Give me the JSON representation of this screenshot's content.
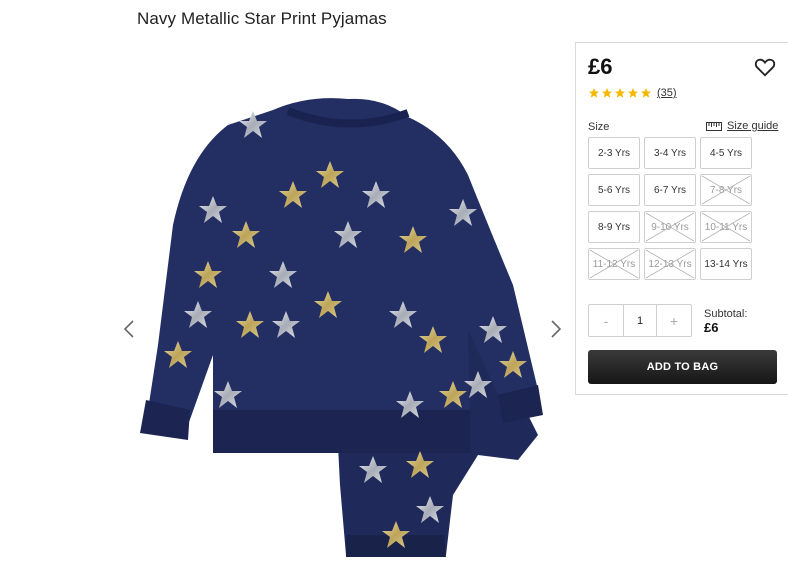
{
  "product": {
    "title": "Navy Metallic Star Print Pyjamas",
    "image_icon": "pyjamas-product-photo"
  },
  "gallery": {
    "prev_icon": "chevron-left-icon",
    "next_icon": "chevron-right-icon"
  },
  "purchase": {
    "price": "£6",
    "wishlist_icon": "heart-icon",
    "rating": {
      "stars": 5,
      "review_count": "(35)",
      "star_color": "#f5b800"
    },
    "size_label": "Size",
    "size_guide_label": "Size guide",
    "size_guide_icon": "ruler-icon",
    "sizes": [
      {
        "label": "2-3 Yrs",
        "available": true
      },
      {
        "label": "3-4 Yrs",
        "available": true
      },
      {
        "label": "4-5 Yrs",
        "available": true
      },
      {
        "label": "5-6 Yrs",
        "available": true
      },
      {
        "label": "6-7 Yrs",
        "available": true
      },
      {
        "label": "7-8 Yrs",
        "available": false
      },
      {
        "label": "8-9 Yrs",
        "available": true
      },
      {
        "label": "9-10 Yrs",
        "available": false
      },
      {
        "label": "10-11 Yrs",
        "available": false
      },
      {
        "label": "11-12 Yrs",
        "available": false
      },
      {
        "label": "12-13 Yrs",
        "available": false
      },
      {
        "label": "13-14 Yrs",
        "available": true
      }
    ],
    "quantity": {
      "minus": "-",
      "value": "1",
      "plus": "+"
    },
    "subtotal_label": "Subtotal:",
    "subtotal_value": "£6",
    "add_to_bag_label": "ADD TO BAG",
    "button_color": "#1f1f1f"
  }
}
